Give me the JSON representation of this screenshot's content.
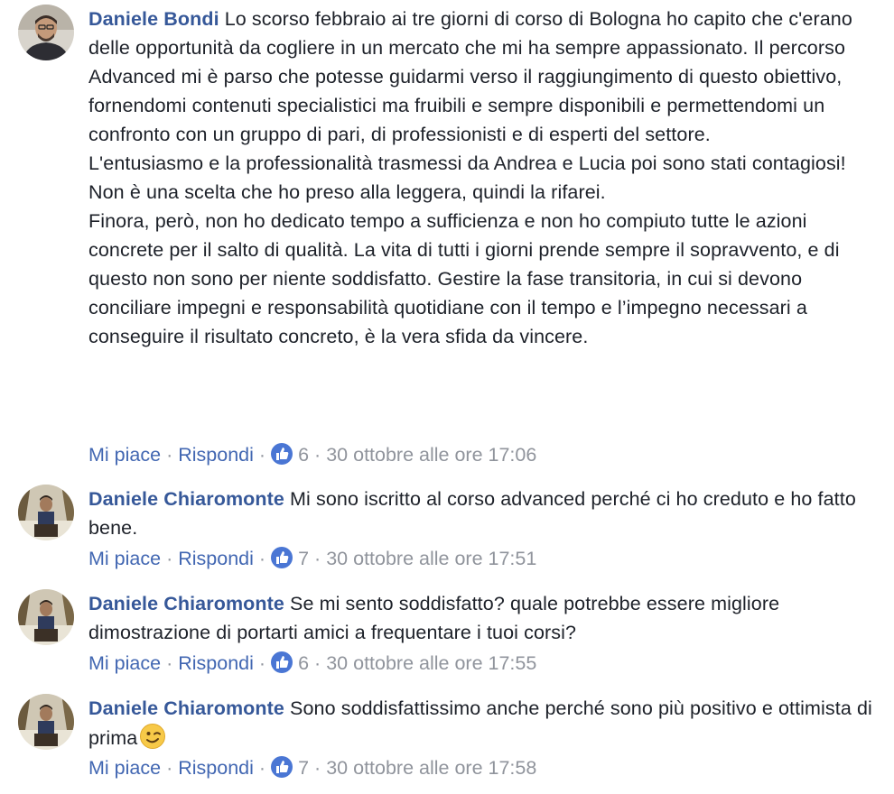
{
  "comments": [
    {
      "author": "Daniele Bondi",
      "paragraphs": [
        "Lo scorso febbraio ai tre giorni di corso di Bologna ho capito che c'erano delle opportunità da cogliere in un mercato che mi ha sempre appassionato. Il percorso Advanced mi è parso che potesse guidarmi verso il raggiungimento di questo obiettivo, fornendomi contenuti specialistici ma fruibili e sempre disponibili e permettendomi un confronto con un gruppo di pari, di professionisti e di esperti del settore.",
        "L'entusiasmo e la professionalità trasmessi da Andrea e Lucia poi sono stati contagiosi!",
        "Non è una scelta che ho preso alla leggera, quindi la rifarei.",
        "Finora, però, non ho dedicato tempo a sufficienza e non ho compiuto tutte le azioni concrete per il salto di qualità. La vita di tutti i giorni prende sempre il sopravvento, e di questo non sono per niente soddisfatto. Gestire la fase transitoria, in cui si devono conciliare impegni e responsabilità quotidiane con il tempo e l’impegno necessari a conseguire il risultato concreto, è la vera sfida da vincere."
      ],
      "like_label": "Mi piace",
      "reply_label": "Rispondi",
      "reactions": "6",
      "timestamp": "30 ottobre alle ore 17:06"
    },
    {
      "author": "Daniele Chiaromonte",
      "text": "Mi sono iscritto al corso advanced perché ci ho creduto e ho fatto bene.",
      "like_label": "Mi piace",
      "reply_label": "Rispondi",
      "reactions": "7",
      "timestamp": "30 ottobre alle ore 17:51"
    },
    {
      "author": "Daniele Chiaromonte",
      "text": "Se mi sento soddisfatto? quale potrebbe essere migliore dimostrazione di portarti amici a frequentare i tuoi corsi?",
      "like_label": "Mi piace",
      "reply_label": "Rispondi",
      "reactions": "6",
      "timestamp": "30 ottobre alle ore 17:55"
    },
    {
      "author": "Daniele Chiaromonte",
      "text": "Sono soddisfattissimo anche perché sono più positivo e ottimista di prima",
      "emoji": "wink-emoji",
      "like_label": "Mi piace",
      "reply_label": "Rispondi",
      "reactions": "7",
      "timestamp": "30 ottobre alle ore 17:58"
    }
  ],
  "separator": "·",
  "icons": {
    "like": "thumbs-up-icon",
    "emoji": "wink-emoji-icon"
  },
  "colors": {
    "author": "#365899",
    "link": "#4267b2",
    "meta": "#90949c",
    "like_badge": "#4a76d4"
  }
}
